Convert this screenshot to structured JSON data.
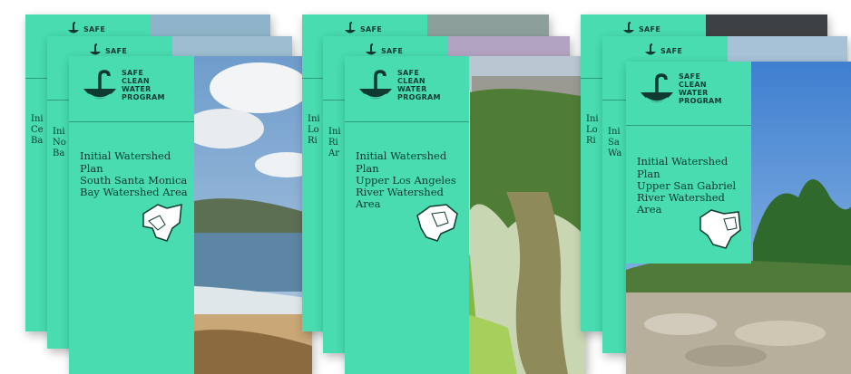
{
  "logo": {
    "lines": "SAFE\nCLEAN\nWATER\nPROGRAM",
    "short": "SAFE"
  },
  "plan_label": "Initial Watershed Plan",
  "front_cards": [
    {
      "area": "South Santa Monica Bay Watershed Area"
    },
    {
      "area": "Upper Los Angeles River Watershed Area"
    },
    {
      "area": "Upper San Gabriel River Watershed Area"
    }
  ],
  "peek_texts": {
    "stack1_back": "Ini\nCe\nBa",
    "stack1_mid": "Ini\nNo\nBa",
    "stack2_back": "Ini\nLo\nRi",
    "stack2_mid": "Ini\nRi\nAr",
    "stack3_back": "Ini\nLo\nRi",
    "stack3_mid": "Ini\nSa\nWa"
  },
  "colors": {
    "panel": "#48dcb0",
    "ink": "#0e3a30"
  }
}
